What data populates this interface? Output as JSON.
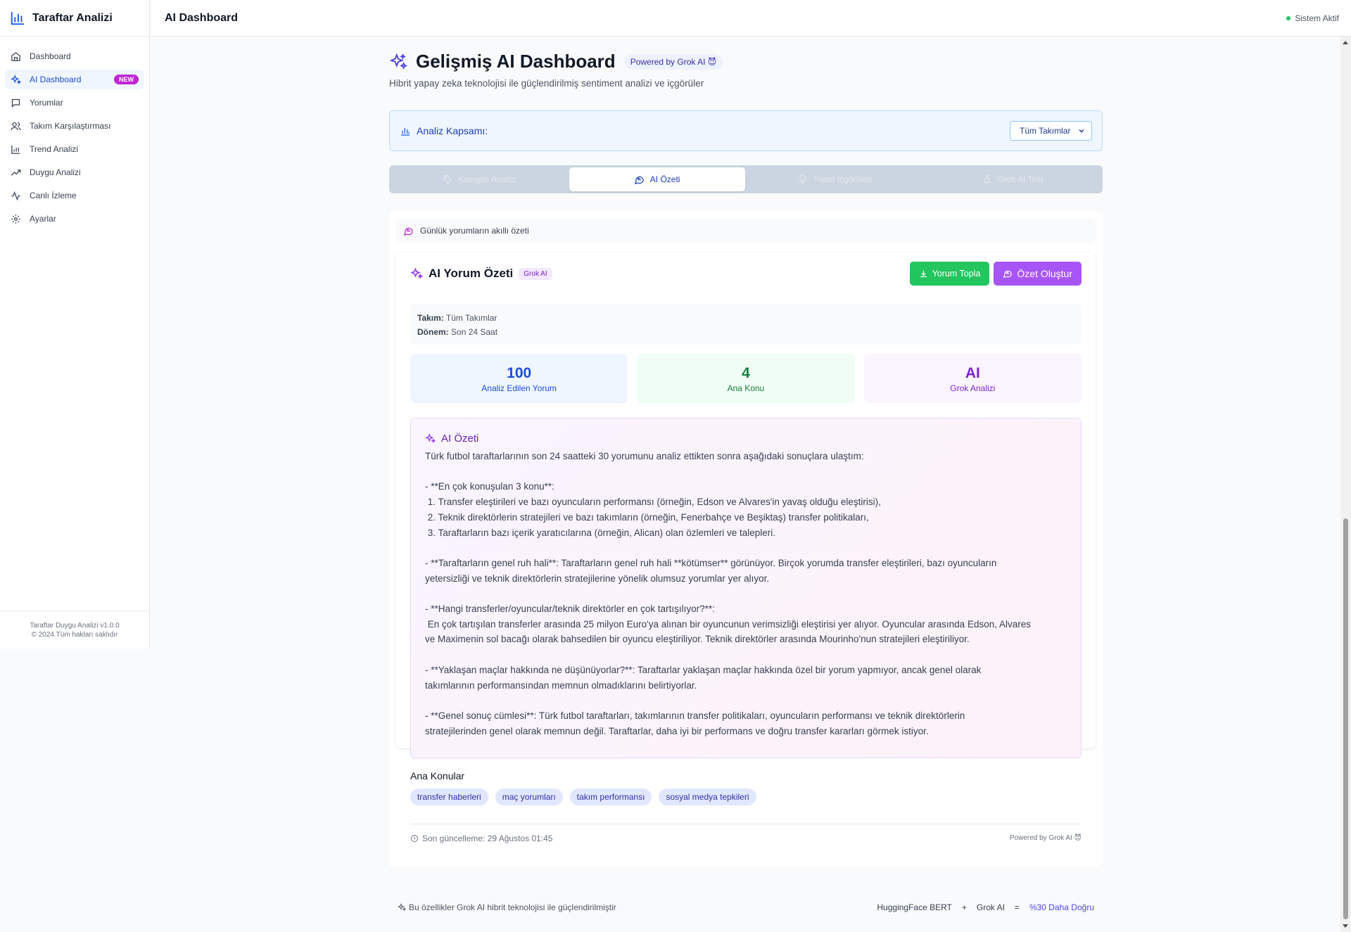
{
  "app": {
    "brand_title": "Taraftar Analizi",
    "footer_version": "Taraftar Duygu Analizi v1.0.0",
    "footer_copyright": "© 2024 Tüm hakları saklıdır"
  },
  "sidebar": {
    "items": [
      {
        "label": "Dashboard",
        "icon": "home-icon"
      },
      {
        "label": "AI Dashboard",
        "icon": "sparkles-icon",
        "badge": "NEW",
        "active": true
      },
      {
        "label": "Yorumlar",
        "icon": "message-square-icon"
      },
      {
        "label": "Takım Karşılaştırması",
        "icon": "users-icon"
      },
      {
        "label": "Trend Analizi",
        "icon": "bar-chart-icon"
      },
      {
        "label": "Duygu Analizi",
        "icon": "trending-up-icon"
      },
      {
        "label": "Canlı İzleme",
        "icon": "activity-icon"
      },
      {
        "label": "Ayarlar",
        "icon": "gear-icon"
      }
    ]
  },
  "topbar": {
    "title": "AI Dashboard",
    "status": "Sistem Aktif"
  },
  "hero": {
    "title": "Gelişmiş AI Dashboard",
    "badge": "Powered by Grok AI 😈",
    "subtitle": "Hibrit yapay zeka teknolojisi ile güçlendirilmiş sentiment analizi ve içgörüler"
  },
  "scope": {
    "label": "Analiz Kapsamı:",
    "selected": "Tüm Takımlar"
  },
  "tabs": [
    {
      "label": "Kategori Analizi",
      "icon": "tag-icon"
    },
    {
      "label": "AI Özeti",
      "icon": "message-circle-icon",
      "active": true
    },
    {
      "label": "Trend İçgörüleri",
      "icon": "lightbulb-icon"
    },
    {
      "label": "Grok AI Test",
      "icon": "flask-icon"
    }
  ],
  "panel": {
    "header": "Günlük yorumların akıllı özeti"
  },
  "card": {
    "title": "AI Yorum Özeti",
    "badge": "Grok AI",
    "collect_button": "Yorum Topla",
    "summary_button": "Özet Oluştur",
    "team_label": "Takım:",
    "team_value": "Tüm Takımlar",
    "period_label": "Dönem:",
    "period_value": "Son 24 Saat"
  },
  "stats": [
    {
      "value": "100",
      "label": "Analiz Edilen Yorum",
      "color": "#1d4ed8"
    },
    {
      "value": "4",
      "label": "Ana Konu",
      "color": "#15803d"
    },
    {
      "value": "AI",
      "label": "Grok Analizi",
      "color": "#7e22ce"
    }
  ],
  "summary": {
    "title": "AI Özeti",
    "text": "Türk futbol taraftarlarının son 24 saatteki 30 yorumunu analiz ettikten sonra aşağıdaki sonuçlara ulaştım:\n\n- **En çok konuşulan 3 konu**:\n 1. Transfer eleştirileri ve bazı oyuncuların performansı (örneğin, Edson ve Alvares'in yavaş olduğu eleştirisi),\n 2. Teknik direktörlerin stratejileri ve bazı takımların (örneğin, Fenerbahçe ve Beşiktaş) transfer politikaları,\n 3. Taraftarların bazı içerik yaratıcılarına (örneğin, Alican) olan özlemleri ve talepleri.\n\n- **Taraftarların genel ruh hali**: Taraftarların genel ruh hali **kötümser** görünüyor. Birçok yorumda transfer eleştirileri, bazı oyuncuların\nyetersizliği ve teknik direktörlerin stratejilerine yönelik olumsuz yorumlar yer alıyor.\n\n- **Hangi transferler/oyuncular/teknik direktörler en çok tartışılıyor?**:\n En çok tartışılan transferler arasında 25 milyon Euro'ya alınan bir oyuncunun verimsizliği eleştirisi yer alıyor. Oyuncular arasında Edson, Alvares\nve Maximenin sol bacağı olarak bahsedilen bir oyuncu eleştiriliyor. Teknik direktörler arasında Mourinho'nun stratejileri eleştiriliyor.\n\n- **Yaklaşan maçlar hakkında ne düşünüyorlar?**: Taraftarlar yaklaşan maçlar hakkında özel bir yorum yapmıyor, ancak genel olarak\ntakımlarının performansından memnun olmadıklarını belirtiyorlar.\n\n- **Genel sonuç cümlesi**: Türk futbol taraftarları, takımlarının transfer politikaları, oyuncuların performansı ve teknik direktörlerin\nstratejilerinden genel olarak memnun değil. Taraftarlar, daha iyi bir performans ve doğru transfer kararları görmek istiyor."
  },
  "topics": {
    "title": "Ana Konular",
    "items": [
      "transfer haberleri",
      "maç yorumları",
      "takım performansı",
      "sosyal medya tepkileri"
    ]
  },
  "card_footer": {
    "updated": "Son güncelleme: 29 Ağustos 01:45",
    "powered": "Powered by Grok AI 😈"
  },
  "bottom": {
    "note": "Bu özellikler Grok AI hibrit teknolojisi ile güçlendirilmiştir",
    "model_a": "HuggingFace BERT",
    "plus": "+",
    "model_b": "Grok AI",
    "equals": "=",
    "result": "%30 Daha Doğru"
  },
  "colors": {
    "accent": "#1d4ed8",
    "purple": "#a855f7",
    "green": "#22c55e",
    "status": "#22c55e"
  }
}
